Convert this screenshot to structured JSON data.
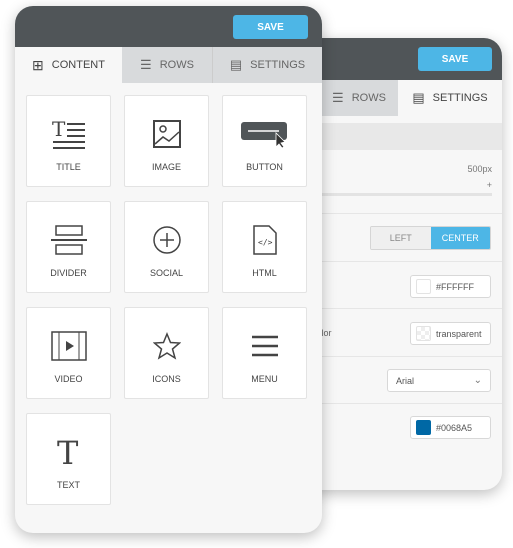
{
  "back_panel": {
    "save_label": "SAVE",
    "tabs": [
      {
        "label": "ROWS",
        "icon": "rows-icon"
      },
      {
        "label": "SETTINGS",
        "icon": "settings-icon"
      }
    ],
    "width_value": "500px",
    "width_plus": "+",
    "align": {
      "options": [
        "LEFT",
        "CENTER"
      ],
      "selected": "CENTER"
    },
    "bg_color": "#FFFFFF",
    "content_bg_label": "color",
    "content_bg": "transparent",
    "font": "Arial",
    "link_color": "#0068A5"
  },
  "front_panel": {
    "save_label": "SAVE",
    "tabs": [
      {
        "label": "CONTENT",
        "icon": "grid-icon"
      },
      {
        "label": "ROWS",
        "icon": "rows-icon"
      },
      {
        "label": "SETTINGS",
        "icon": "settings-icon"
      }
    ],
    "blocks": [
      {
        "label": "TITLE"
      },
      {
        "label": "IMAGE"
      },
      {
        "label": "BUTTON"
      },
      {
        "label": "DIVIDER"
      },
      {
        "label": "SOCIAL"
      },
      {
        "label": "HTML"
      },
      {
        "label": "VIDEO"
      },
      {
        "label": "ICONS"
      },
      {
        "label": "MENU"
      },
      {
        "label": "TEXT"
      }
    ]
  },
  "colors": {
    "header": "#505558",
    "accent": "#4DB6E6",
    "link": "#0068A5"
  }
}
